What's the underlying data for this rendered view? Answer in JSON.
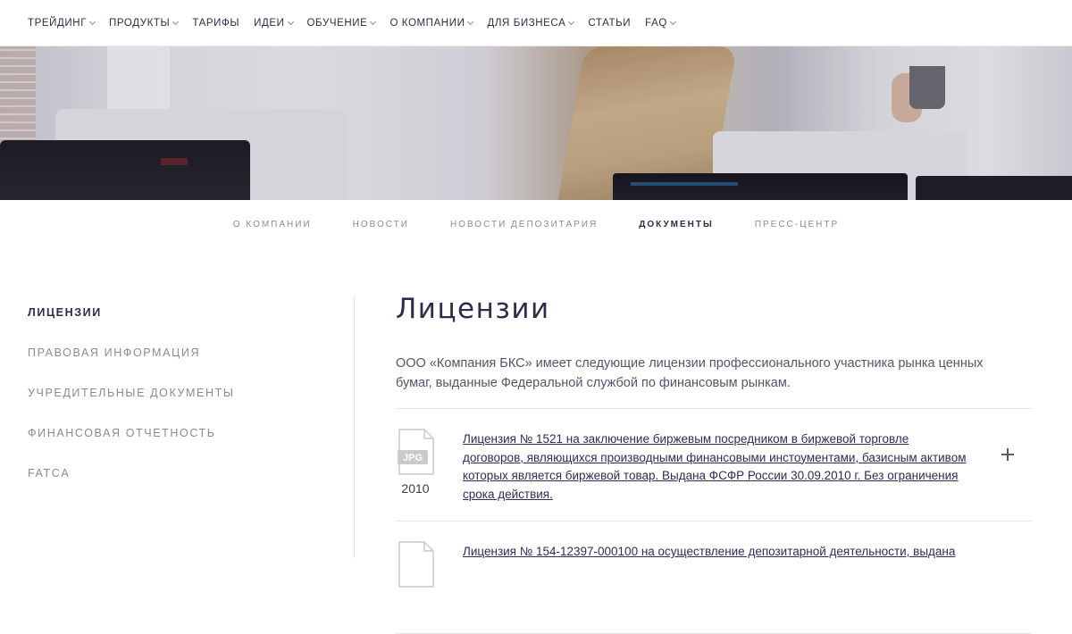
{
  "topnav": {
    "items": [
      {
        "label": "Трейдинг",
        "has_dropdown": true
      },
      {
        "label": "Продукты",
        "has_dropdown": true
      },
      {
        "label": "Тарифы",
        "has_dropdown": false
      },
      {
        "label": "Идеи",
        "has_dropdown": true
      },
      {
        "label": "Обучение",
        "has_dropdown": true
      },
      {
        "label": "О компании",
        "has_dropdown": true
      },
      {
        "label": "Для бизнеса",
        "has_dropdown": true
      },
      {
        "label": "Статьи",
        "has_dropdown": false
      },
      {
        "label": "FAQ",
        "has_dropdown": true
      }
    ]
  },
  "subnav": {
    "items": [
      {
        "label": "О компании",
        "active": false
      },
      {
        "label": "Новости",
        "active": false
      },
      {
        "label": "Новости депозитария",
        "active": false
      },
      {
        "label": "Документы",
        "active": true
      },
      {
        "label": "Пресс-центр",
        "active": false
      }
    ]
  },
  "sidebar": {
    "items": [
      {
        "label": "Лицензии",
        "active": true
      },
      {
        "label": "Правовая информация",
        "active": false
      },
      {
        "label": "Учредительные документы",
        "active": false
      },
      {
        "label": "Финансовая отчетность",
        "active": false
      },
      {
        "label": "FATCA",
        "active": false
      }
    ]
  },
  "main": {
    "title": "Лицензии",
    "intro": "ООО «Компания БКС» имеет следующие лицензии профессионального участника рынка ценных бумаг, выданные Федеральной службой по финансовым рынкам.",
    "documents": [
      {
        "file_type": "JPG",
        "year": "2010",
        "title": "Лицензия № 1521 на заключение биржевым посредником в биржевой торговле договоров, являющихся производными финансовыми инстоументами, базисным активом которых является биржевой товар. Выдана ФСФР России 30.09.2010 г. Без ограничения срока действия.",
        "icon": "plus-icon"
      },
      {
        "file_type": "",
        "year": "",
        "title": "Лицензия № 154-12397-000100 на осуществление депозитарной деятельности, выдана",
        "icon": "plus-icon"
      }
    ]
  },
  "colors": {
    "text_dark": "#2d2d4a",
    "text_muted": "#8a8a96",
    "divider": "#e4e4ea",
    "link": "#2d2d55"
  }
}
